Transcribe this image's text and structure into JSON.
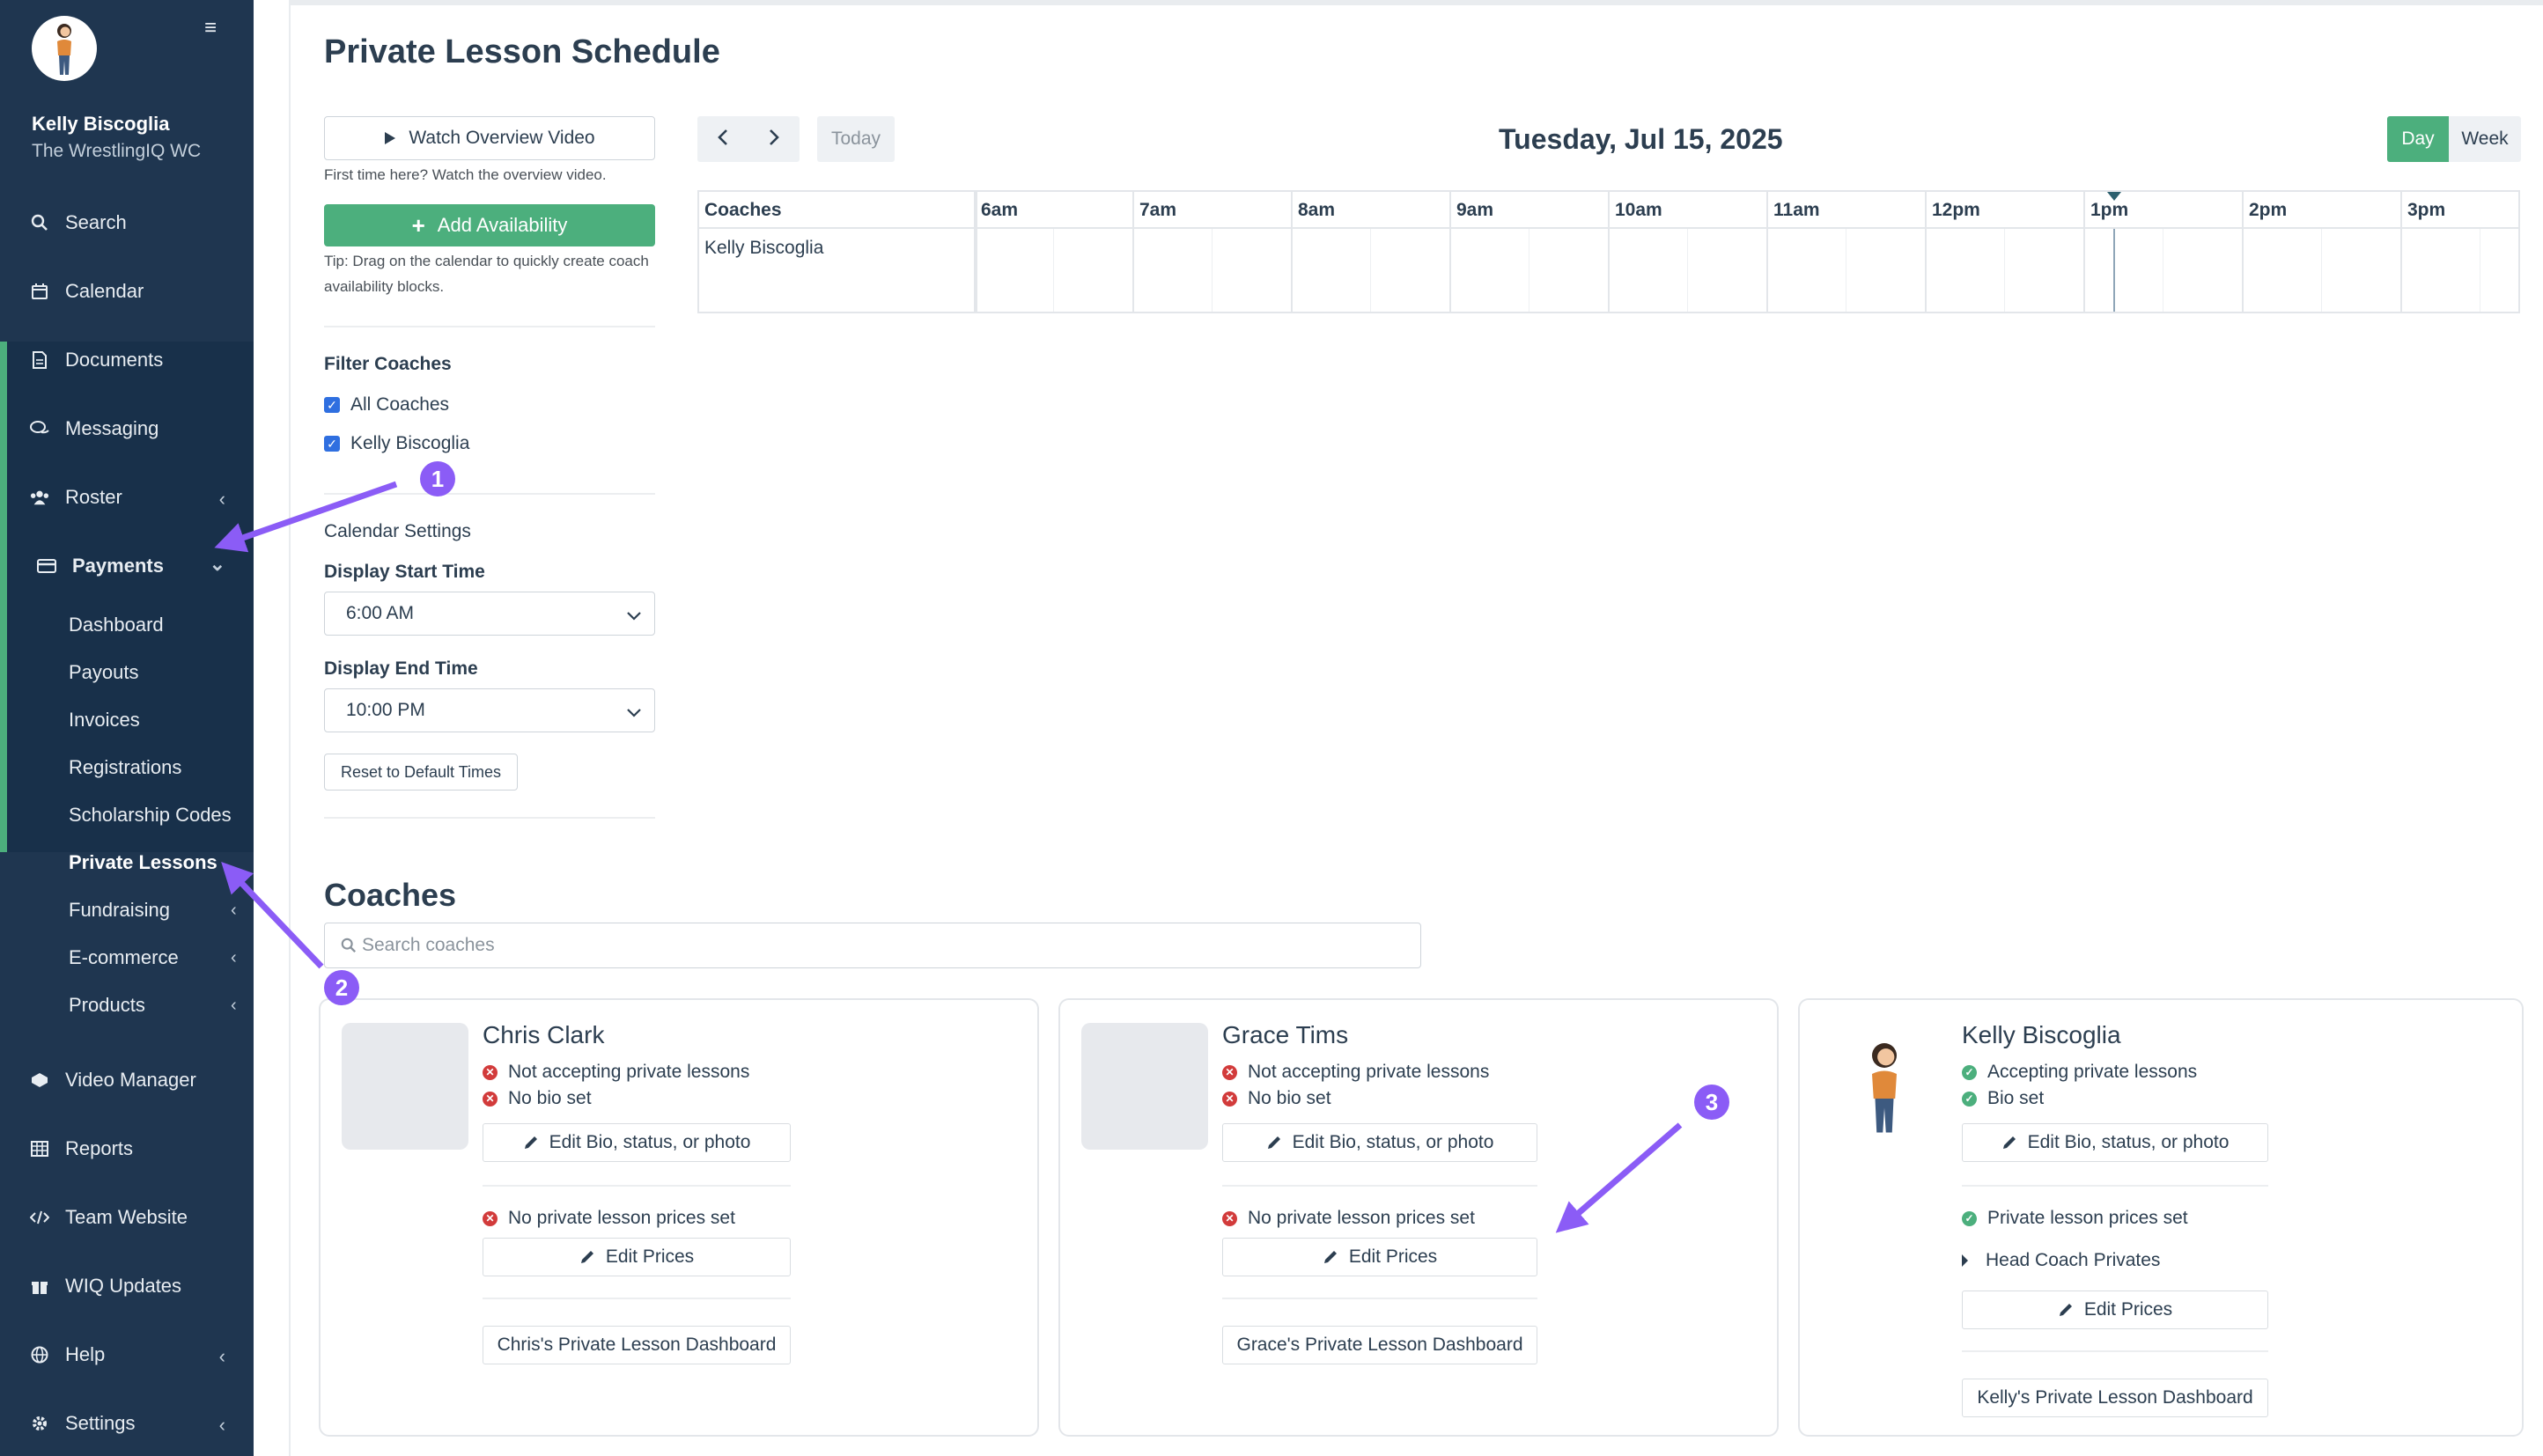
{
  "sidebar": {
    "user_name": "Kelly Biscoglia",
    "team_name": "The WrestlingIQ WC",
    "nav": [
      {
        "label": "Search",
        "icon": "search-icon"
      },
      {
        "label": "Calendar",
        "icon": "calendar-icon"
      },
      {
        "label": "Documents",
        "icon": "document-icon"
      },
      {
        "label": "Messaging",
        "icon": "chat-icon"
      },
      {
        "label": "Roster",
        "icon": "users-icon"
      },
      {
        "label": "Payments",
        "icon": "credit-card-icon"
      },
      {
        "label": "Video Manager",
        "icon": "video-icon"
      },
      {
        "label": "Reports",
        "icon": "table-icon"
      },
      {
        "label": "Team Website",
        "icon": "code-icon"
      },
      {
        "label": "WIQ Updates",
        "icon": "gift-icon"
      },
      {
        "label": "Help",
        "icon": "globe-icon"
      },
      {
        "label": "Settings",
        "icon": "gear-icon"
      }
    ],
    "payments_sub": [
      {
        "label": "Dashboard"
      },
      {
        "label": "Payouts"
      },
      {
        "label": "Invoices"
      },
      {
        "label": "Registrations"
      },
      {
        "label": "Scholarship Codes"
      },
      {
        "label": "Private Lessons"
      },
      {
        "label": "Fundraising"
      },
      {
        "label": "E-commerce"
      },
      {
        "label": "Products"
      }
    ]
  },
  "page": {
    "title": "Private Lesson Schedule",
    "watch_video_label": "Watch Overview Video",
    "watch_video_note": "First time here? Watch the overview video.",
    "add_availability_label": "Add Availability",
    "add_tip": "Tip: Drag on the calendar to quickly create coach availability blocks.",
    "filter_title": "Filter Coaches",
    "filter_all": "All Coaches",
    "filter_coach": "Kelly Biscoglia",
    "calendar_settings_title": "Calendar Settings",
    "start_label": "Display Start Time",
    "start_value": "6:00 AM",
    "end_label": "Display End Time",
    "end_value": "10:00 PM",
    "reset_label": "Reset to Default Times"
  },
  "calendar": {
    "today_label": "Today",
    "date": "Tuesday, Jul 15, 2025",
    "view_day": "Day",
    "view_week": "Week",
    "coaches_header": "Coaches",
    "coach_row": "Kelly Biscoglia",
    "hours": [
      "6am",
      "7am",
      "8am",
      "9am",
      "10am",
      "11am",
      "12pm",
      "1pm",
      "2pm",
      "3pm"
    ]
  },
  "coaches": {
    "title": "Coaches",
    "search_placeholder": "Search coaches",
    "cards": [
      {
        "name": "Chris Clark",
        "status1": "Not accepting private lessons",
        "status2": "No bio set",
        "edit_bio": "Edit Bio, status, or photo",
        "prices_status": "No private lesson prices set",
        "edit_prices": "Edit Prices",
        "dashboard": "Chris's Private Lesson Dashboard"
      },
      {
        "name": "Grace Tims",
        "status1": "Not accepting private lessons",
        "status2": "No bio set",
        "edit_bio": "Edit Bio, status, or photo",
        "prices_status": "No private lesson prices set",
        "edit_prices": "Edit Prices",
        "dashboard": "Grace's Private Lesson Dashboard"
      },
      {
        "name": "Kelly Biscoglia",
        "status1": "Accepting private lessons",
        "status2": "Bio set",
        "edit_bio": "Edit Bio, status, or photo",
        "prices_status": "Private lesson prices set",
        "price_item": "Head Coach Privates",
        "edit_prices": "Edit Prices",
        "dashboard": "Kelly's Private Lesson Dashboard"
      }
    ]
  },
  "annotations": [
    "1",
    "2",
    "3"
  ],
  "colors": {
    "sidebar_bg": "#1f3650",
    "accent_green": "#4caf7d",
    "error_red": "#d23b3b",
    "annotation_purple": "#8b5cf6"
  }
}
